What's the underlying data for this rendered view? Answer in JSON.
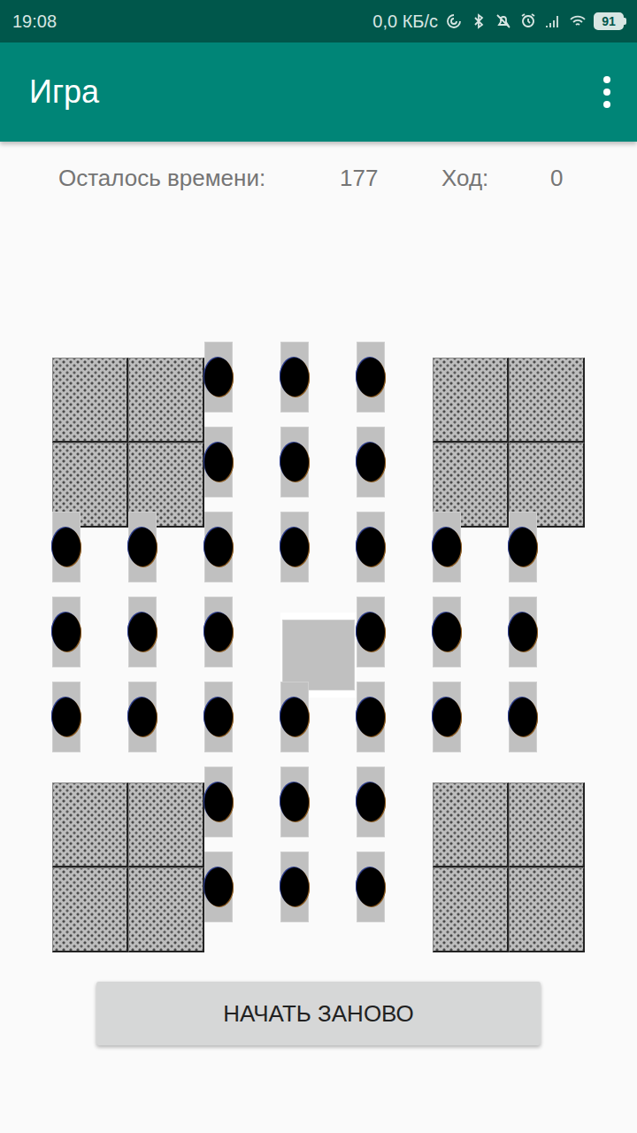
{
  "status_bar": {
    "time": "19:08",
    "speed": "0,0 КБ/с",
    "battery": "91"
  },
  "app_bar": {
    "title": "Игра"
  },
  "info": {
    "time_label": "Осталось времени:",
    "time_value": "177",
    "move_label": "Ход:",
    "move_value": "0"
  },
  "board": {
    "rows": [
      [
        {
          "kind": "blocked"
        },
        {
          "kind": "blocked"
        },
        {
          "kind": "peg"
        },
        {
          "kind": "peg"
        },
        {
          "kind": "peg"
        },
        {
          "kind": "blocked"
        },
        {
          "kind": "blocked"
        }
      ],
      [
        {
          "kind": "blocked"
        },
        {
          "kind": "blocked"
        },
        {
          "kind": "peg"
        },
        {
          "kind": "peg"
        },
        {
          "kind": "peg"
        },
        {
          "kind": "blocked"
        },
        {
          "kind": "blocked"
        }
      ],
      [
        {
          "kind": "peg"
        },
        {
          "kind": "peg"
        },
        {
          "kind": "peg"
        },
        {
          "kind": "peg"
        },
        {
          "kind": "peg"
        },
        {
          "kind": "peg"
        },
        {
          "kind": "peg"
        }
      ],
      [
        {
          "kind": "peg"
        },
        {
          "kind": "peg"
        },
        {
          "kind": "peg"
        },
        {
          "kind": "empty"
        },
        {
          "kind": "peg"
        },
        {
          "kind": "peg"
        },
        {
          "kind": "peg"
        }
      ],
      [
        {
          "kind": "peg"
        },
        {
          "kind": "peg"
        },
        {
          "kind": "peg"
        },
        {
          "kind": "peg"
        },
        {
          "kind": "peg"
        },
        {
          "kind": "peg"
        },
        {
          "kind": "peg"
        }
      ],
      [
        {
          "kind": "blocked"
        },
        {
          "kind": "blocked"
        },
        {
          "kind": "peg"
        },
        {
          "kind": "peg"
        },
        {
          "kind": "peg"
        },
        {
          "kind": "blocked"
        },
        {
          "kind": "blocked"
        }
      ],
      [
        {
          "kind": "blocked"
        },
        {
          "kind": "blocked"
        },
        {
          "kind": "peg"
        },
        {
          "kind": "peg"
        },
        {
          "kind": "peg"
        },
        {
          "kind": "blocked"
        },
        {
          "kind": "blocked"
        }
      ]
    ]
  },
  "buttons": [
    "НАЧАТЬ ЗАНОВО"
  ]
}
